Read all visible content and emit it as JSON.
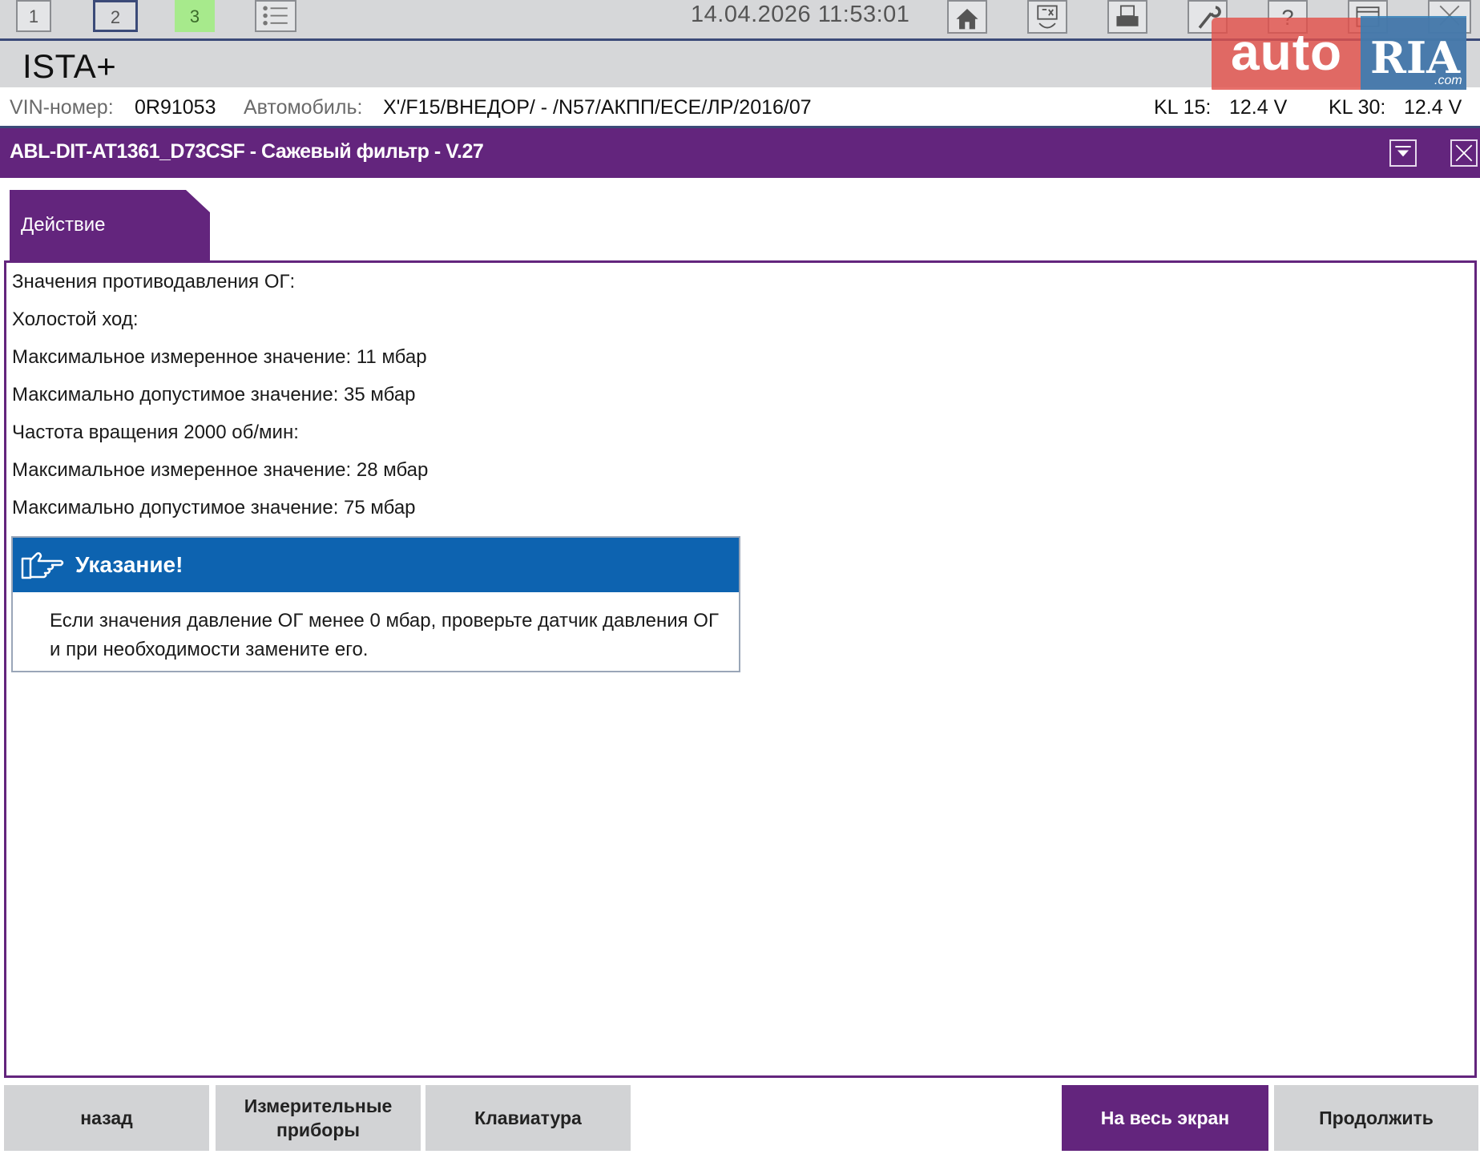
{
  "toolbar": {
    "tabs": [
      "1",
      "2",
      "3"
    ],
    "datetime": "14.04.2026 11:53:01",
    "icons": [
      "list-icon",
      "home-icon",
      "vehicle-scan-icon",
      "printer-icon",
      "wrench-icon",
      "help-icon",
      "window-icon",
      "close-icon"
    ]
  },
  "app": {
    "title": "ISTA+"
  },
  "watermark": {
    "auto": "auto",
    "ria": "RIA",
    "com": ".com"
  },
  "vehicle": {
    "vin_label": "VIN-номер:",
    "vin_value": "0R91053",
    "car_label": "Автомобиль:",
    "car_value": "X'/F15/ВНЕДОР/ - /N57/АКПП/ЕСЕ/ЛР/2016/07",
    "kl15_label": "KL 15:",
    "kl15_value": "12.4 V",
    "kl30_label": "KL 30:",
    "kl30_value": "12.4 V"
  },
  "window": {
    "title": "ABL-DIT-AT1361_D73CSF - Сажевый фильтр - V.27"
  },
  "tab": {
    "label": "Действие"
  },
  "content": {
    "lines": [
      "Значения противодавления ОГ:",
      "Холостой ход:",
      "Максимальное измеренное значение: 11 мбар",
      "Максимально допустимое значение: 35 мбар",
      "Частота вращения 2000 об/мин:",
      "Максимальное измеренное значение: 28 мбар",
      "Максимально допустимое значение: 75 мбар"
    ],
    "note": {
      "title": "Указание!",
      "body": "Если значения давление ОГ менее 0 мбар, проверьте датчик давления ОГ и при необходимости замените его."
    }
  },
  "buttons": {
    "back": "назад",
    "meters": "Измерительные приборы",
    "keyboard": "Клавиатура",
    "fullscreen": "На весь экран",
    "continue": "Продолжить"
  },
  "colors": {
    "accent": "#63257d",
    "toolbar": "#d6d7d9",
    "note_header": "#0d63b0",
    "active_tab": "#a7ea8c"
  }
}
